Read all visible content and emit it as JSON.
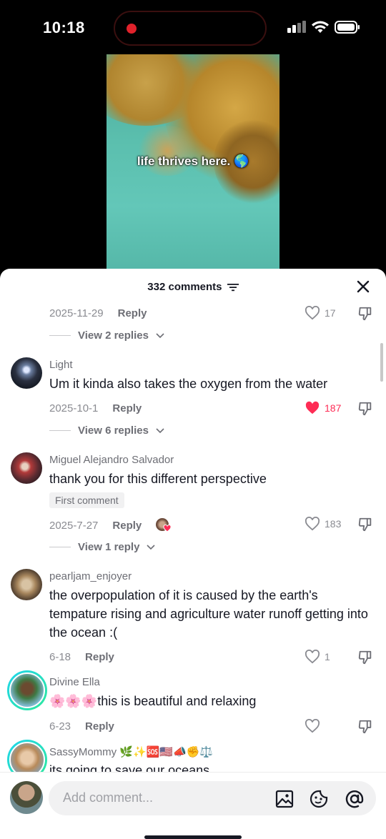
{
  "status_bar": {
    "time": "10:18"
  },
  "video": {
    "caption": "life thrives here. 🌎"
  },
  "sheet": {
    "title": "332 comments"
  },
  "comments": [
    {
      "date": "2025-11-29",
      "reply": "Reply",
      "likes": "17",
      "view_replies": "View 2 replies"
    },
    {
      "user": "Light",
      "text": "Um it kinda also takes the oxygen from the water",
      "date": "2025-10-1",
      "reply": "Reply",
      "likes": "187",
      "liked": true,
      "view_replies": "View 6 replies"
    },
    {
      "user": "Miguel Alejandro Salvador",
      "text": "thank you for this different perspective",
      "badge": "First comment",
      "date": "2025-7-27",
      "reply": "Reply",
      "likes": "183",
      "view_replies": "View 1 reply"
    },
    {
      "user": "pearljam_enjoyer",
      "text": "the overpopulation of it is caused by the earth's tempature rising and agriculture water runoff getting into the ocean :(",
      "date": "6-18",
      "reply": "Reply",
      "likes": "1"
    },
    {
      "user": "Divine Ella",
      "text": "🌸🌸🌸this is beautiful and relaxing",
      "date": "6-23",
      "reply": "Reply",
      "likes": ""
    },
    {
      "user": "SassyMommy 🌿✨🆘🇺🇸📣✊⚖️",
      "text": "its going to save our oceans"
    }
  ],
  "input": {
    "placeholder": "Add comment..."
  },
  "colors": {
    "liked": "#fe2c55",
    "accent_ring": "#20d5ec"
  }
}
